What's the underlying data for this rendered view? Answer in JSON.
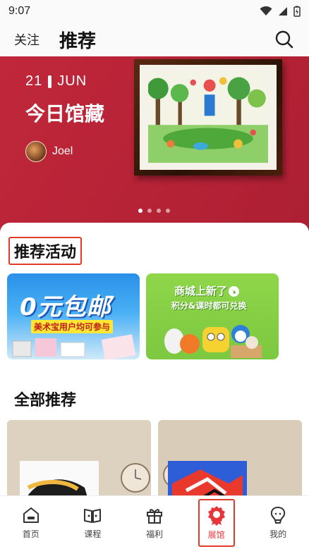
{
  "status_bar": {
    "time": "9:07"
  },
  "header": {
    "follow_label": "关注",
    "recommend_label": "推荐"
  },
  "banner": {
    "date_day": "21",
    "date_month": "JUN",
    "title": "今日馆藏",
    "user_name": "Joel",
    "page_count": 4,
    "active_page": 1
  },
  "activities": {
    "title": "推荐活动",
    "cards": [
      {
        "headline": "0元包邮",
        "subline": "美术宝用户均可参与"
      },
      {
        "headline": "商城上新了",
        "subline": "积分&课时都可兑换"
      }
    ]
  },
  "all": {
    "title": "全部推荐"
  },
  "tabbar": {
    "items": [
      {
        "label": "首页",
        "icon": "home-icon"
      },
      {
        "label": "课程",
        "icon": "book-icon"
      },
      {
        "label": "福利",
        "icon": "gift-icon"
      },
      {
        "label": "展馆",
        "icon": "museum-icon",
        "active": true
      },
      {
        "label": "我的",
        "icon": "profile-icon"
      }
    ]
  },
  "colors": {
    "accent": "#e6353b",
    "banner": "#b52136"
  }
}
